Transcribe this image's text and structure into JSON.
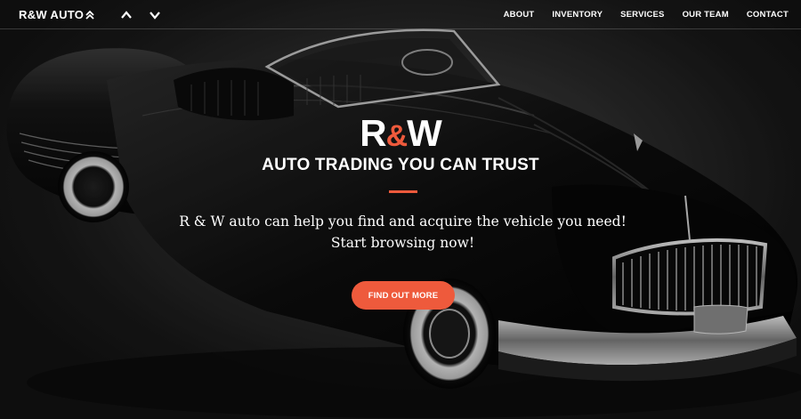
{
  "navbar": {
    "brand": "R&W AUTO",
    "icons": [
      "double-chevron-up-icon",
      "chevron-up-icon",
      "chevron-down-icon"
    ],
    "links": [
      "ABOUT",
      "INVENTORY",
      "SERVICES",
      "OUR TEAM",
      "CONTACT"
    ]
  },
  "hero": {
    "logo_left": "R",
    "logo_amp": "&",
    "logo_right": "W",
    "title": "AUTO TRADING YOU CAN TRUST",
    "text": "R & W auto can help you find and acquire the vehicle you need! Start browsing now!",
    "cta_label": "FIND OUT MORE"
  },
  "colors": {
    "accent": "#ee5a3c",
    "text": "#ffffff",
    "background": "#1a1a1a"
  },
  "background_image": "black-vintage-convertible-car"
}
